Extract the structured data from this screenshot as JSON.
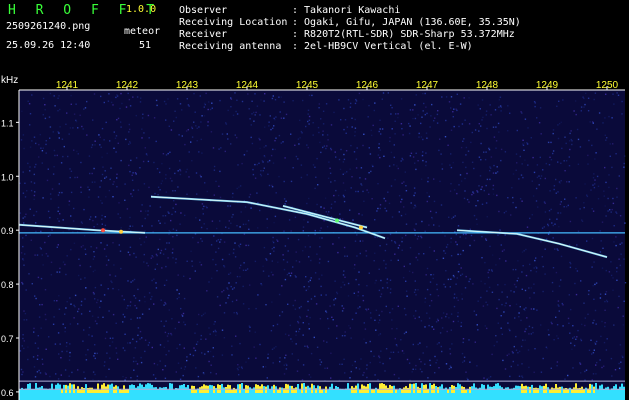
{
  "app": {
    "name": "H R O F F T",
    "version": "1.0.0"
  },
  "file": {
    "name": "2509261240.png",
    "datetime": "25.09.26 12:40"
  },
  "meteor": {
    "label": "meteor",
    "count": "51"
  },
  "info": [
    {
      "label": "Observer",
      "value": ": Takanori Kawachi"
    },
    {
      "label": "Receiving Location",
      "value": ": Ogaki, Gifu, JAPAN (136.60E, 35.35N)"
    },
    {
      "label": "Receiver",
      "value": ": R820T2(RTL-SDR) SDR-Sharp 53.372MHz"
    },
    {
      "label": "Receiving antenna",
      "value": ": 2el-HB9CV Vertical (el. E-W)"
    }
  ],
  "chart_data": {
    "type": "spectrogram",
    "ylabel": "kHz",
    "x_ticks": [
      "1241",
      "1242",
      "1243",
      "1244",
      "1245",
      "1246",
      "1247",
      "1248",
      "1249",
      "1250"
    ],
    "y_ticks": [
      "1.1",
      "1.0",
      "0.9",
      "0.8",
      "0.7",
      "0.6"
    ],
    "xlim": [
      1240.2,
      1250.3
    ],
    "ylim": [
      0.585,
      1.16
    ],
    "carrier_khz": 0.895,
    "noise_floor_lines_khz": [
      0.62,
      0.605
    ],
    "echo_traces": [
      {
        "points": [
          [
            1240.2,
            0.91
          ],
          [
            1241.5,
            0.9
          ],
          [
            1242.3,
            0.895
          ]
        ]
      },
      {
        "points": [
          [
            1242.4,
            0.962
          ],
          [
            1244.0,
            0.952
          ],
          [
            1245.0,
            0.93
          ],
          [
            1245.8,
            0.905
          ],
          [
            1246.3,
            0.885
          ]
        ]
      },
      {
        "points": [
          [
            1244.6,
            0.945
          ],
          [
            1245.3,
            0.925
          ],
          [
            1246.0,
            0.905
          ]
        ]
      },
      {
        "points": [
          [
            1247.5,
            0.9
          ],
          [
            1248.5,
            0.893
          ],
          [
            1249.2,
            0.875
          ],
          [
            1250.0,
            0.85
          ]
        ]
      }
    ],
    "colors": {
      "background": "#0a0a3a",
      "axis": "#ffffff",
      "tick_label": "#ffff33",
      "carrier": "#44bbff",
      "floor_bar": "#33e0ff",
      "floor_peak": "#ffee33"
    }
  }
}
